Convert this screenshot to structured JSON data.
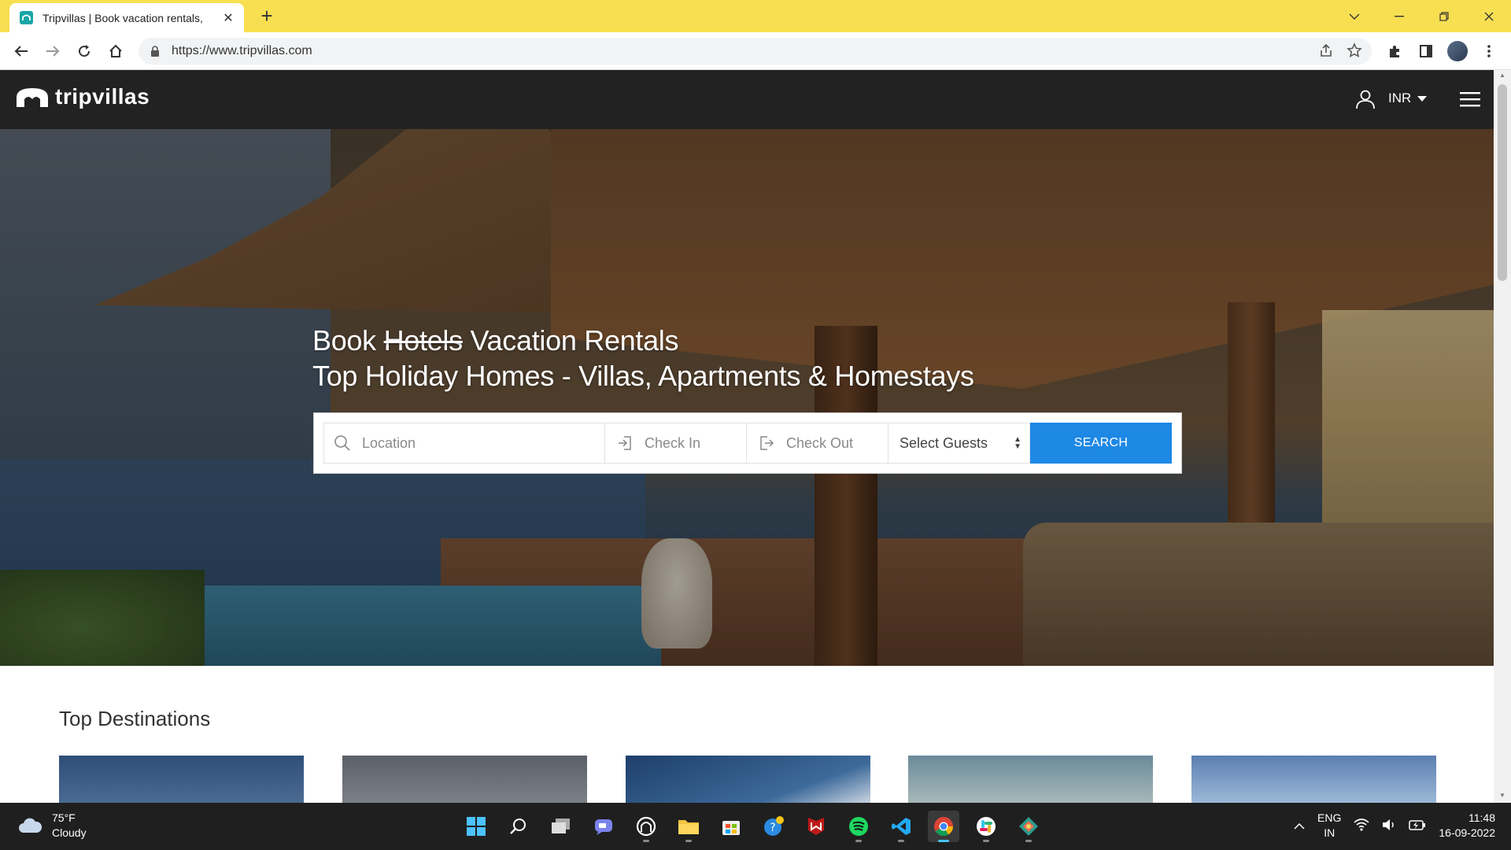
{
  "browser": {
    "tab_title": "Tripvillas | Book vacation rentals,",
    "url": "https://www.tripvillas.com"
  },
  "site": {
    "logo_text": "tripvillas",
    "currency": "INR"
  },
  "hero": {
    "title_word1": "Book",
    "title_strike": "Hotels",
    "title_rest": "Vacation Rentals",
    "subtitle": "Top Holiday Homes - Villas, Apartments & Homestays"
  },
  "search": {
    "location_placeholder": "Location",
    "checkin_placeholder": "Check In",
    "checkout_placeholder": "Check Out",
    "guests_selected": "Select Guests",
    "search_label": "SEARCH",
    "accent_color": "#1e88e5"
  },
  "sections": {
    "top_destinations": "Top Destinations"
  },
  "taskbar": {
    "weather_temp": "75°F",
    "weather_desc": "Cloudy",
    "lang_top": "ENG",
    "lang_bottom": "IN",
    "time": "11:48",
    "date": "16-09-2022"
  }
}
